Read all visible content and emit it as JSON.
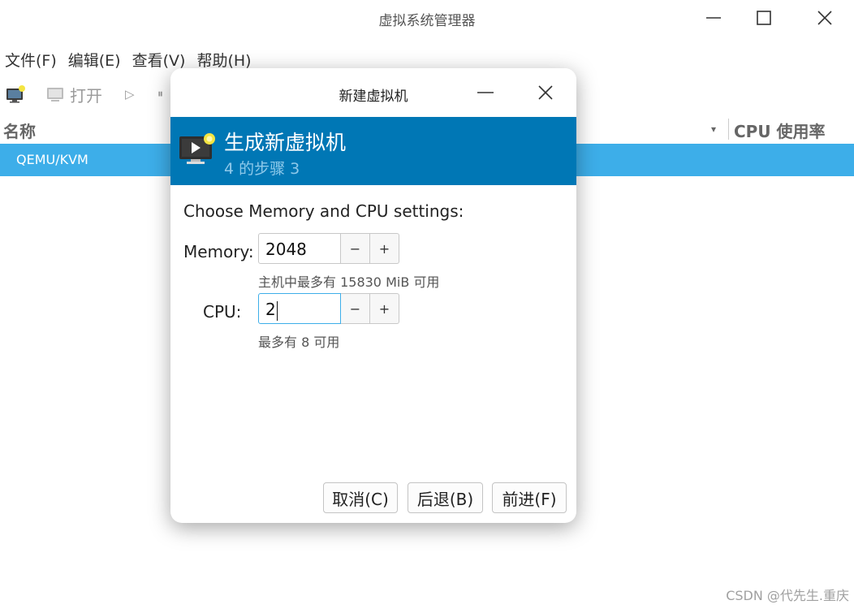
{
  "main_window": {
    "title": "虚拟系统管理器",
    "menu": [
      "文件(F)",
      "编辑(E)",
      "查看(V)",
      "帮助(H)"
    ],
    "toolbar": {
      "open_label": "打开"
    },
    "columns": {
      "name": "名称",
      "cpu_usage": "CPU 使用率"
    },
    "connections": [
      {
        "label": "QEMU/KVM",
        "selected": true
      }
    ]
  },
  "dialog": {
    "title": "新建虚拟机",
    "header": {
      "title": "生成新虚拟机",
      "subtitle": "4 的步骤 3"
    },
    "prompt": "Choose Memory and CPU settings:",
    "memory": {
      "label": "Memory:",
      "value": "2048",
      "hint": "主机中最多有 15830 MiB 可用"
    },
    "cpu": {
      "label": "CPU:",
      "value": "2",
      "hint": "最多有 8 可用"
    },
    "spin": {
      "minus": "−",
      "plus": "+"
    },
    "buttons": {
      "cancel": "取消(C)",
      "back": "后退(B)",
      "forward": "前进(F)"
    }
  },
  "colors": {
    "accent": "#3daee9",
    "header_bg": "#0077b5"
  },
  "watermark": "CSDN @代先生.重庆"
}
